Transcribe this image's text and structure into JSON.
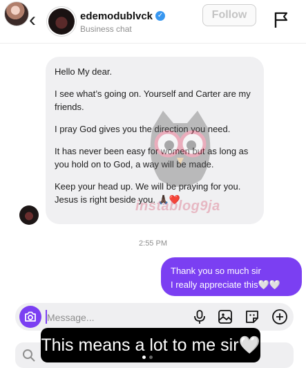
{
  "header": {
    "username": "edemodublvck",
    "subtitle": "Business chat",
    "follow_label": "Follow",
    "back_icon": "back-chevron-icon",
    "report_icon": "flag-icon"
  },
  "messages": {
    "incoming": [
      "Hello My dear.",
      "I see what’s going on. Yourself and Carter are my friends.",
      "I pray God gives you the direction you need.",
      "It has never been easy for women but as long as you hold on to God, a way will be made.",
      "Keep your head up. We will be praying for you. Jesus is right beside you. 🙏🏿❤️"
    ],
    "timestamp": "2:55 PM",
    "outgoing": [
      "Thank you so much sir",
      "I really appreciate this🤍🤍"
    ]
  },
  "composer": {
    "placeholder": "Message...",
    "icons": [
      "camera-icon",
      "microphone-icon",
      "gallery-icon",
      "sticker-icon",
      "add-icon"
    ]
  },
  "watermark": "instablog9ja",
  "caption": "This means a lot to me sir🤍",
  "colors": {
    "accent": "#7b3ff2",
    "incoming_bubble": "#f0f0f2",
    "verified": "#3897f0"
  }
}
